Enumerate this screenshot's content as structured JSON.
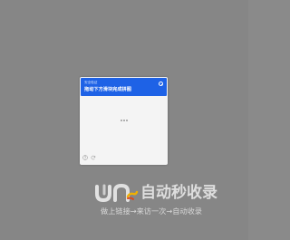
{
  "dialog": {
    "header_small": "安全验证",
    "title": "拖动下方滑块完成拼图",
    "close_icon": "close-circle-icon",
    "loading_icon": "loading-dots-icon",
    "help_icon": "help-circle-icon",
    "refresh_icon": "refresh-icon"
  },
  "watermark": {
    "name": "自动秒收录",
    "slogan": "做上链接→来访一次→自动收录"
  },
  "colors": {
    "backdrop": "#868686",
    "header_blue": "#1e62e6",
    "dialog_bg": "#f4f4f4",
    "watermark_text": "#dedede"
  }
}
